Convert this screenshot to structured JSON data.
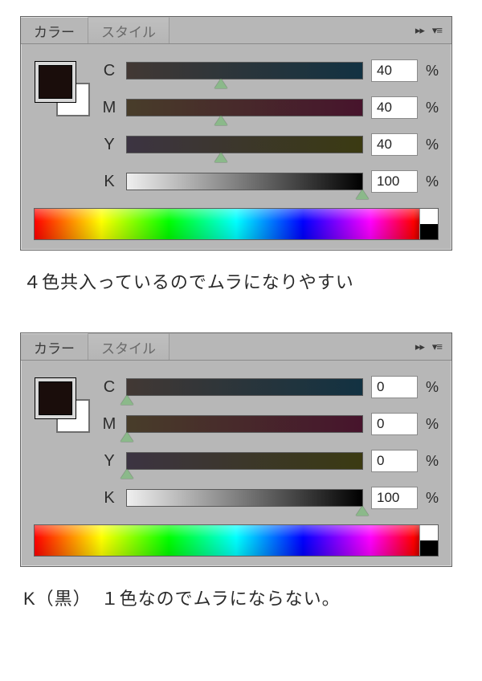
{
  "panels": [
    {
      "tabs": {
        "active": "カラー",
        "inactive": "スタイル"
      },
      "swatch_color": "#1a0d0b",
      "channels": {
        "c": {
          "label": "C",
          "value": "40",
          "handle_pct": 40,
          "unit": "%"
        },
        "m": {
          "label": "M",
          "value": "40",
          "handle_pct": 40,
          "unit": "%"
        },
        "y": {
          "label": "Y",
          "value": "40",
          "handle_pct": 40,
          "unit": "%"
        },
        "k": {
          "label": "K",
          "value": "100",
          "handle_pct": 100,
          "unit": "%"
        }
      },
      "caption": "４色共入っているのでムラになりやすい"
    },
    {
      "tabs": {
        "active": "カラー",
        "inactive": "スタイル"
      },
      "swatch_color": "#1a0d0b",
      "channels": {
        "c": {
          "label": "C",
          "value": "0",
          "handle_pct": 0,
          "unit": "%"
        },
        "m": {
          "label": "M",
          "value": "0",
          "handle_pct": 0,
          "unit": "%"
        },
        "y": {
          "label": "Y",
          "value": "0",
          "handle_pct": 0,
          "unit": "%"
        },
        "k": {
          "label": "K",
          "value": "100",
          "handle_pct": 100,
          "unit": "%"
        }
      },
      "caption": "K（黒）　１色なのでムラにならない。"
    }
  ],
  "icons": {
    "collapse": "▸▸",
    "menu": "▾≡"
  }
}
